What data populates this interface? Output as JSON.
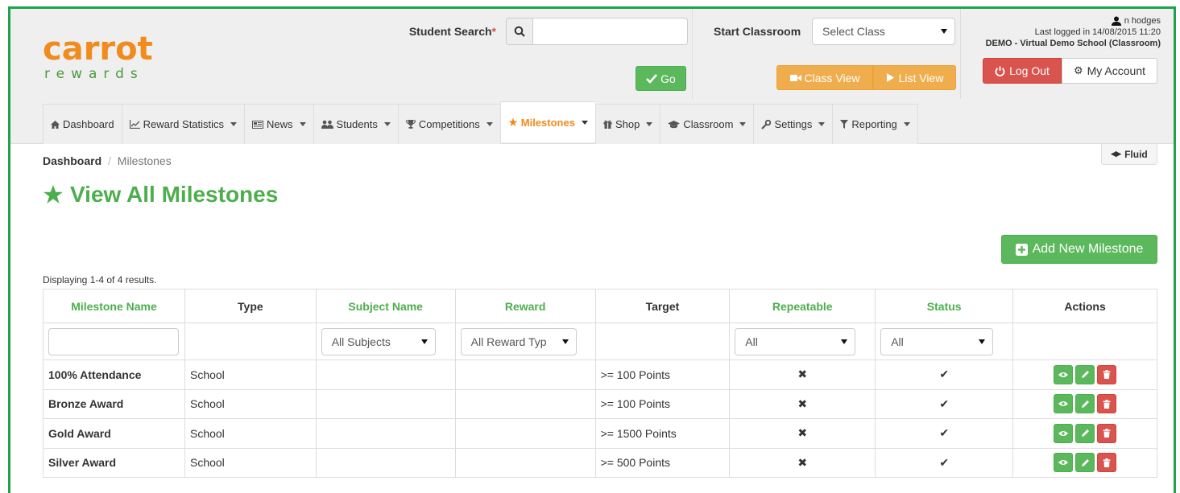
{
  "logo": {
    "top": "carrot",
    "bottom": "rewards"
  },
  "header": {
    "student_search_label": "Student Search",
    "required_mark": "*",
    "student_search_value": "",
    "go_label": "Go",
    "start_classroom_label": "Start Classroom",
    "select_class_value": "Select Class",
    "class_view_label": "Class View",
    "list_view_label": "List View",
    "user_name": "n hodges",
    "last_logged": "Last logged in 14/08/2015 11:20",
    "school": "DEMO - Virtual Demo School (Classroom)",
    "logout_label": "Log Out",
    "account_label": "My Account"
  },
  "nav": [
    {
      "label": "Dashboard",
      "dropdown": false
    },
    {
      "label": "Reward Statistics",
      "dropdown": true
    },
    {
      "label": "News",
      "dropdown": true
    },
    {
      "label": "Students",
      "dropdown": true
    },
    {
      "label": "Competitions",
      "dropdown": true
    },
    {
      "label": "Milestones",
      "dropdown": true,
      "active": true
    },
    {
      "label": "Shop",
      "dropdown": true
    },
    {
      "label": "Classroom",
      "dropdown": true
    },
    {
      "label": "Settings",
      "dropdown": true
    },
    {
      "label": "Reporting",
      "dropdown": true
    }
  ],
  "breadcrumb": {
    "root": "Dashboard",
    "separator": "/",
    "current": "Milestones"
  },
  "fluid_label": "Fluid",
  "page_title": "View All Milestones",
  "add_button_label": "Add New Milestone",
  "results_summary": "Displaying 1-4 of 4 results.",
  "table": {
    "columns": [
      {
        "label": "Milestone Name",
        "sortable": true
      },
      {
        "label": "Type",
        "sortable": false
      },
      {
        "label": "Subject Name",
        "sortable": true
      },
      {
        "label": "Reward",
        "sortable": true
      },
      {
        "label": "Target",
        "sortable": false
      },
      {
        "label": "Repeatable",
        "sortable": true
      },
      {
        "label": "Status",
        "sortable": true
      },
      {
        "label": "Actions",
        "sortable": false
      }
    ],
    "filters": {
      "name_value": "",
      "subject_value": "All Subjects",
      "reward_value": "All Reward Typ",
      "repeatable_value": "All",
      "status_value": "All"
    },
    "rows": [
      {
        "name": "100% Attendance",
        "type": "School",
        "subject": "",
        "reward": "",
        "target": ">= 100 Points",
        "repeatable": "✖",
        "status": "✔"
      },
      {
        "name": "Bronze Award",
        "type": "School",
        "subject": "",
        "reward": "",
        "target": ">= 100 Points",
        "repeatable": "✖",
        "status": "✔"
      },
      {
        "name": "Gold Award",
        "type": "School",
        "subject": "",
        "reward": "",
        "target": ">= 1500 Points",
        "repeatable": "✖",
        "status": "✔"
      },
      {
        "name": "Silver Award",
        "type": "School",
        "subject": "",
        "reward": "",
        "target": ">= 500 Points",
        "repeatable": "✖",
        "status": "✔"
      }
    ]
  },
  "colors": {
    "brand_orange": "#f08b1d",
    "brand_green": "#4cae4c",
    "success": "#5cb85c",
    "warning": "#f0ad4e",
    "danger": "#d9534f",
    "frame_border": "#1fa24a"
  },
  "icons": {
    "search": "search-icon",
    "go": "check-icon",
    "class_view": "video-camera-icon",
    "list_view": "play-icon",
    "user": "user-icon",
    "logout": "power-icon",
    "account": "gear-icon",
    "dashboard": "home-icon",
    "reward_statistics": "line-chart-icon",
    "news": "newspaper-icon",
    "students": "users-icon",
    "competitions": "trophy-icon",
    "milestones": "star-icon",
    "shop": "gift-icon",
    "classroom": "graduation-cap-icon",
    "settings": "wrench-icon",
    "reporting": "filter-icon",
    "fluid": "arrows-horizontal-icon",
    "add": "plus-square-icon",
    "view": "eye-icon",
    "edit": "pencil-icon",
    "delete": "trash-icon",
    "not_repeatable": "cross-icon",
    "active": "check-icon"
  }
}
